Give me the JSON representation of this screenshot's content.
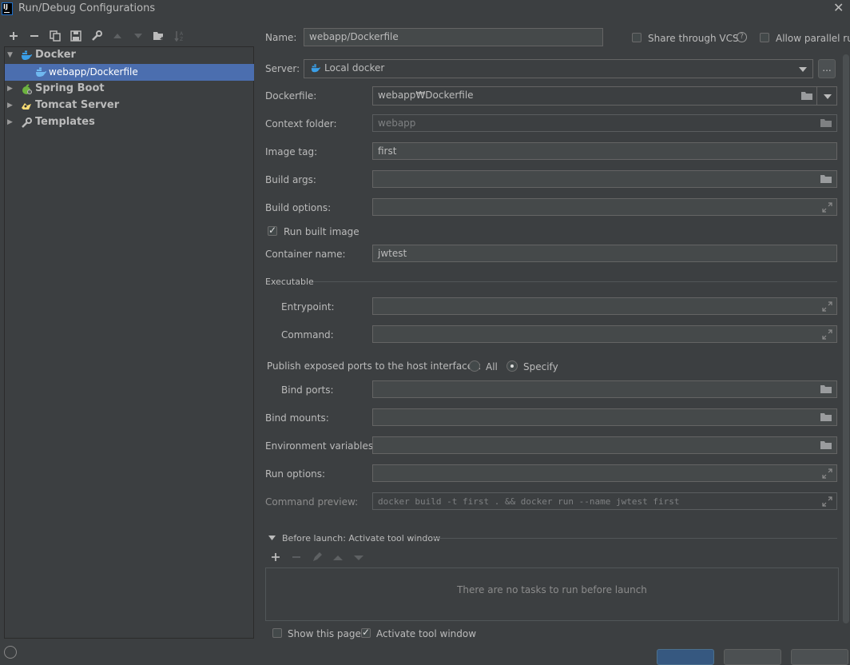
{
  "window": {
    "title": "Run/Debug Configurations",
    "logo_text": "IJ"
  },
  "toolbar": {
    "icons": [
      "add-icon",
      "remove-icon",
      "copy-icon",
      "save-icon",
      "wrench-icon",
      "move-up-icon",
      "move-down-icon",
      "new-folder-icon",
      "sort-icon"
    ]
  },
  "tree": {
    "items": [
      {
        "label": "Docker",
        "icon": "docker-icon",
        "expanded": true
      },
      {
        "label": "webapp/Dockerfile",
        "icon": "docker-icon",
        "selected": true
      },
      {
        "label": "Spring Boot",
        "icon": "spring-boot-icon"
      },
      {
        "label": "Tomcat Server",
        "icon": "tomcat-icon"
      },
      {
        "label": "Templates",
        "icon": "wrench-icon"
      }
    ]
  },
  "form": {
    "name_label": "Name:",
    "name_value": "webapp/Dockerfile",
    "share_vcs_label": "Share through VCS",
    "allow_parallel_label": "Allow parallel run",
    "server_label": "Server:",
    "server_value": "Local docker",
    "more_button": "...",
    "dockerfile_label": "Dockerfile:",
    "dockerfile_value": "webapp₩Dockerfile",
    "context_folder_label": "Context folder:",
    "context_folder_value": "webapp",
    "image_tag_label": "Image tag:",
    "image_tag_value": "first",
    "build_args_label": "Build args:",
    "build_args_value": "",
    "build_options_label": "Build options:",
    "build_options_value": "",
    "run_built_image_label": "Run built image",
    "run_built_image_checked": true,
    "container_name_label": "Container name:",
    "container_name_value": "jwtest",
    "executable_section": "Executable",
    "entrypoint_label": "Entrypoint:",
    "entrypoint_value": "",
    "command_label": "Command:",
    "command_value": "",
    "publish_ports_label": "Publish exposed ports to the host interfaces:",
    "radio_all_label": "All",
    "radio_specify_label": "Specify",
    "publish_ports_selected": "Specify",
    "bind_ports_label": "Bind ports:",
    "bind_ports_value": "",
    "bind_mounts_label": "Bind mounts:",
    "bind_mounts_value": "",
    "env_vars_label": "Environment variables:",
    "env_vars_value": "",
    "run_options_label": "Run options:",
    "run_options_value": "",
    "command_preview_label": "Command preview:",
    "command_preview_value": "docker build -t first . && docker run --name jwtest first"
  },
  "before_launch": {
    "title": "Before launch: Activate tool window",
    "empty_text": "There are no tasks to run before launch",
    "show_page_label": "Show this page",
    "show_page_checked": false,
    "activate_tool_label": "Activate tool window",
    "activate_tool_checked": true
  },
  "colors": {
    "accent": "#4b6eaf",
    "background": "#3c3f41",
    "field": "#45494a"
  }
}
